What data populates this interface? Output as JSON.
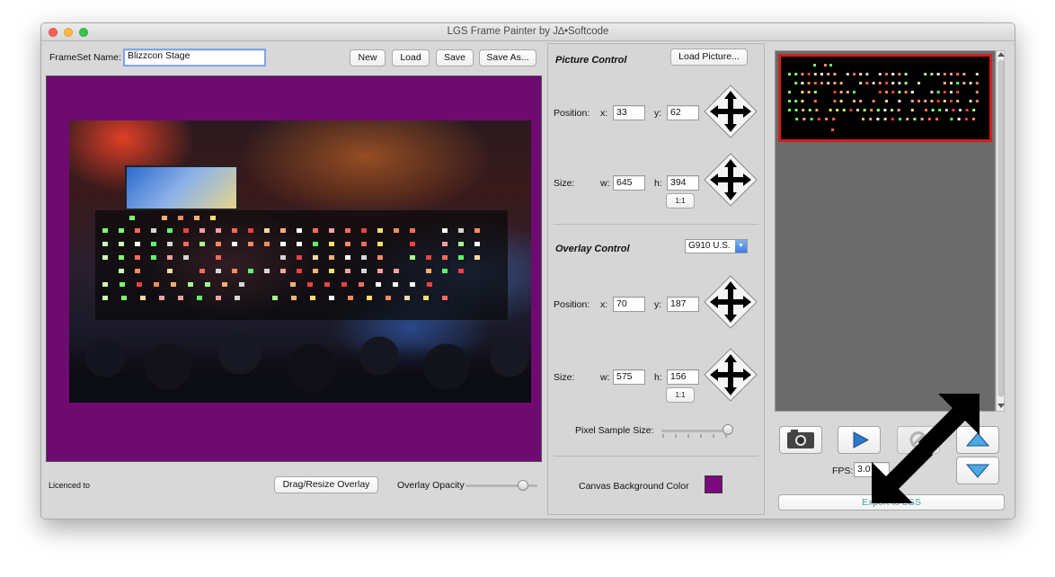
{
  "window": {
    "title": "LGS Frame Painter by J∆•Softcode"
  },
  "frameset": {
    "name_label": "FrameSet Name:",
    "name_value": "Blizzcon Stage"
  },
  "toolbar": {
    "new_label": "New",
    "load_label": "Load",
    "save_label": "Save",
    "save_as_label": "Save As..."
  },
  "canvas": {
    "background_color": "#6e0a70"
  },
  "bottom_bar": {
    "licence_label": "Licenced to",
    "drag_resize_label": "Drag/Resize Overlay",
    "opacity_label": "Overlay Opacity",
    "opacity_value": 0.8
  },
  "picture_control": {
    "title": "Picture Control",
    "load_picture_label": "Load Picture...",
    "position_label": "Position:",
    "x_label": "x:",
    "x_value": "33",
    "y_label": "y:",
    "y_value": "62",
    "size_label": "Size:",
    "w_label": "w:",
    "w_value": "645",
    "h_label": "h:",
    "h_value": "394",
    "ratio_label": "1:1"
  },
  "overlay_control": {
    "title": "Overlay Control",
    "keyboard_selected": "G910 U.S.",
    "position_label": "Position:",
    "x_label": "x:",
    "x_value": "70",
    "y_label": "y:",
    "y_value": "187",
    "size_label": "Size:",
    "w_label": "w:",
    "w_value": "575",
    "h_label": "h:",
    "h_value": "156",
    "ratio_label": "1:1",
    "pixel_sample_label": "Pixel Sample Size:",
    "pixel_sample_value": 0.95
  },
  "canvas_bg": {
    "label": "Canvas Background Color",
    "color": "#7a0a7e"
  },
  "playback": {
    "fps_label": "FPS:",
    "fps_value": "3.0",
    "export_label": "Export to LGS"
  },
  "icons": [
    "camera-icon",
    "play-icon",
    "stop-icon",
    "arrow-up-icon",
    "arrow-down-icon",
    "four-way-arrow-icon",
    "resize-arrow-icon"
  ],
  "colors": {
    "accent_red": "#d11f1f",
    "preview_bg": "#6b6b6b",
    "arrow_blue": "#2f78c8"
  }
}
